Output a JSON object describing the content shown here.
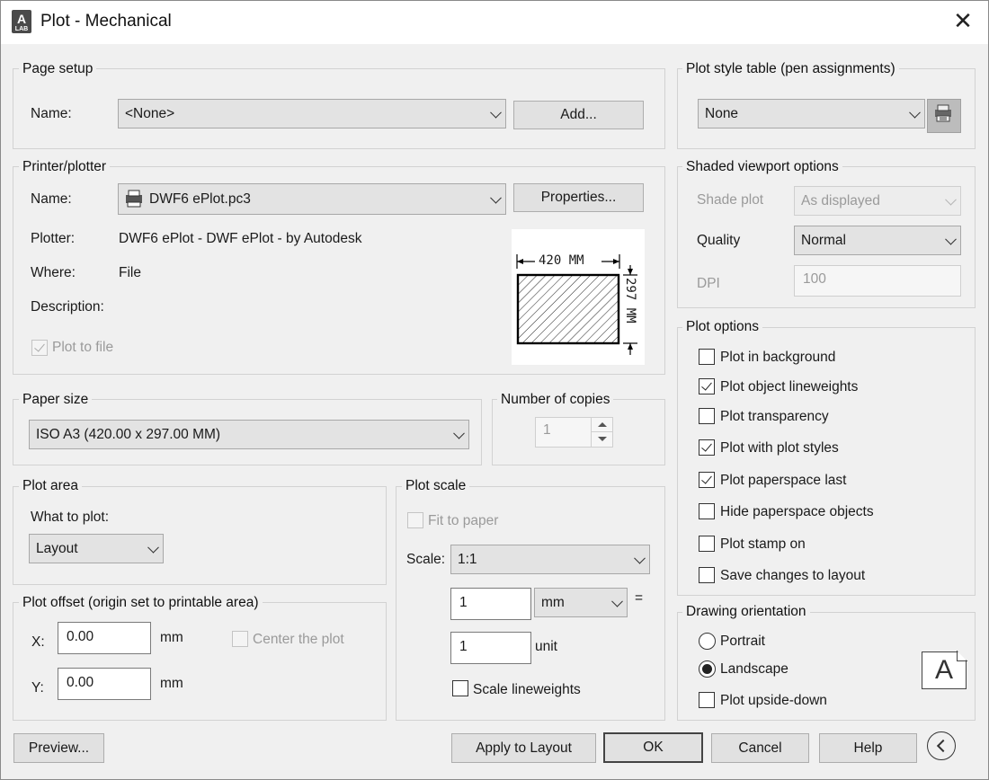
{
  "window": {
    "title": "Plot - Mechanical",
    "app_icon_letter": "A",
    "app_icon_sub": "LAB"
  },
  "page_setup": {
    "legend": "Page setup",
    "name_label": "Name:",
    "name_value": "<None>",
    "add_button": "Add..."
  },
  "printer": {
    "legend": "Printer/plotter",
    "name_label": "Name:",
    "name_value": "DWF6 ePlot.pc3",
    "properties_button": "Properties...",
    "plotter_label": "Plotter:",
    "plotter_value": "DWF6 ePlot - DWF ePlot - by Autodesk",
    "where_label": "Where:",
    "where_value": "File",
    "description_label": "Description:",
    "plot_to_file_label": "Plot to file",
    "plot_to_file_checked": true,
    "preview_width_label": "420  MM",
    "preview_height_label": "297  MM"
  },
  "paper_size": {
    "legend": "Paper size",
    "value": "ISO A3 (420.00 x 297.00 MM)"
  },
  "copies": {
    "legend": "Number of copies",
    "value": "1"
  },
  "plot_area": {
    "legend": "Plot area",
    "what_label": "What to plot:",
    "what_value": "Layout"
  },
  "plot_offset": {
    "legend": "Plot offset (origin set to printable area)",
    "x_label": "X:",
    "x_value": "0.00",
    "y_label": "Y:",
    "y_value": "0.00",
    "unit": "mm",
    "center_label": "Center the plot"
  },
  "plot_scale": {
    "legend": "Plot scale",
    "fit_label": "Fit to paper",
    "scale_label": "Scale:",
    "scale_value": "1:1",
    "value1": "1",
    "unit1": "mm",
    "equals": "=",
    "value2": "1",
    "unit2": "unit",
    "lineweights_label": "Scale lineweights"
  },
  "plot_style": {
    "legend": "Plot style table (pen assignments)",
    "value": "None"
  },
  "shaded": {
    "legend": "Shaded viewport options",
    "shade_label": "Shade plot",
    "shade_value": "As displayed",
    "quality_label": "Quality",
    "quality_value": "Normal",
    "dpi_label": "DPI",
    "dpi_value": "100"
  },
  "plot_options": {
    "legend": "Plot options",
    "items": [
      {
        "label": "Plot in background",
        "checked": false
      },
      {
        "label": "Plot object lineweights",
        "checked": true
      },
      {
        "label": "Plot transparency",
        "checked": false
      },
      {
        "label": "Plot with plot styles",
        "checked": true
      },
      {
        "label": "Plot paperspace last",
        "checked": true
      },
      {
        "label": "Hide paperspace objects",
        "checked": false
      },
      {
        "label": "Plot stamp on",
        "checked": false
      },
      {
        "label": "Save changes to layout",
        "checked": false
      }
    ]
  },
  "orientation": {
    "legend": "Drawing orientation",
    "portrait": "Portrait",
    "landscape": "Landscape",
    "upside_down": "Plot upside-down",
    "selected": "Landscape",
    "icon_letter": "A"
  },
  "buttons": {
    "preview": "Preview...",
    "apply": "Apply to Layout",
    "ok": "OK",
    "cancel": "Cancel",
    "help": "Help"
  },
  "colors": {
    "window_bg": "#f0f0f0",
    "title_bg": "#ffffff",
    "field_bg": "#e3e3e3",
    "disabled_text": "#9a9a9a"
  }
}
